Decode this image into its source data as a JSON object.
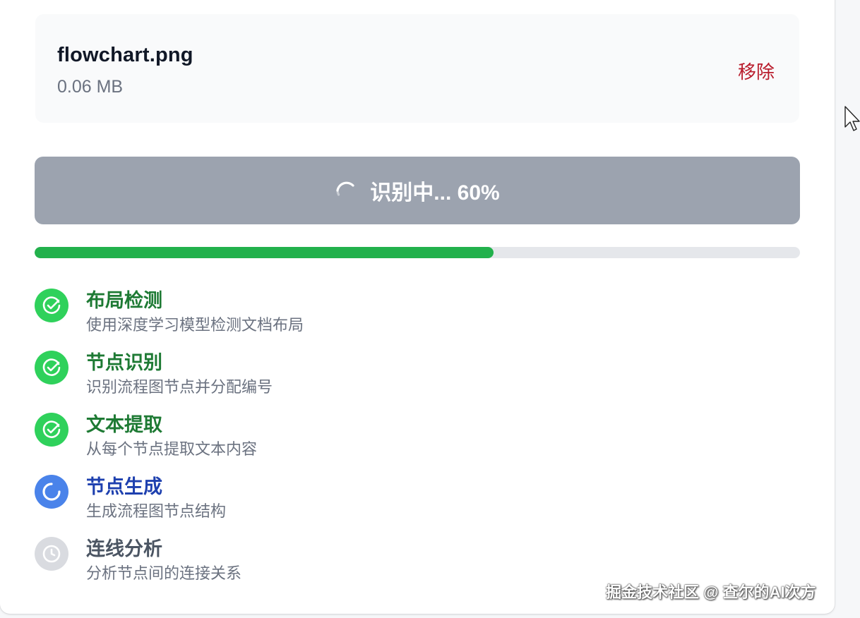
{
  "file": {
    "name": "flowchart.png",
    "size": "0.06 MB",
    "remove_label": "移除"
  },
  "recognize_button": {
    "label": "识别中... 60%"
  },
  "progress": {
    "percent": 60,
    "color": "#22b14c"
  },
  "steps": [
    {
      "title": "布局检测",
      "desc": "使用深度学习模型检测文档布局",
      "status": "done",
      "icon": "check-circle-icon"
    },
    {
      "title": "节点识别",
      "desc": "识别流程图节点并分配编号",
      "status": "done",
      "icon": "check-circle-icon"
    },
    {
      "title": "文本提取",
      "desc": "从每个节点提取文本内容",
      "status": "done",
      "icon": "check-circle-icon"
    },
    {
      "title": "节点生成",
      "desc": "生成流程图节点结构",
      "status": "active",
      "icon": "loading-spinner-icon"
    },
    {
      "title": "连线分析",
      "desc": "分析节点间的连接关系",
      "status": "pending",
      "icon": "clock-icon"
    }
  ],
  "watermark": "掘金技术社区 @ 查尔的AI次方"
}
